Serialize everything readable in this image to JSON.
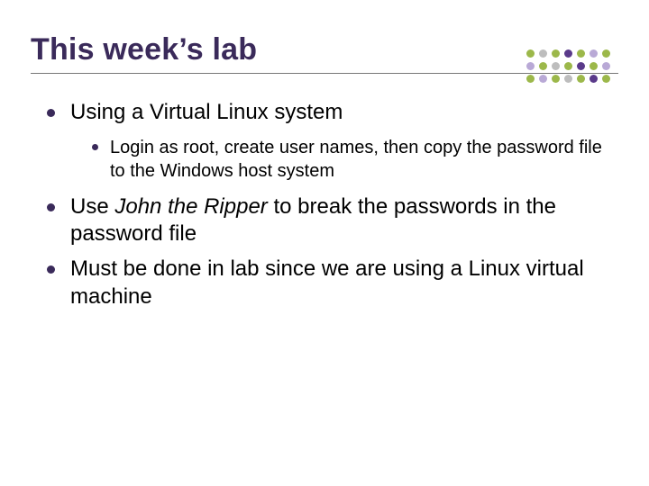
{
  "title": "This week’s lab",
  "bullets": [
    {
      "text": "Using a Virtual Linux system",
      "sub": [
        {
          "text": "Login as root, create user names, then copy the password file to the Windows host system"
        }
      ]
    },
    {
      "pre": "Use ",
      "em": "John the Ripper",
      "post": " to break the passwords in the password file"
    },
    {
      "text": "Must be done in lab since we are using a Linux virtual machine"
    }
  ],
  "deco_colors": {
    "green": "#9cb84a",
    "purple": "#5a3a8a",
    "lav": "#b9a9d6",
    "grey": "#bdbdbd"
  }
}
